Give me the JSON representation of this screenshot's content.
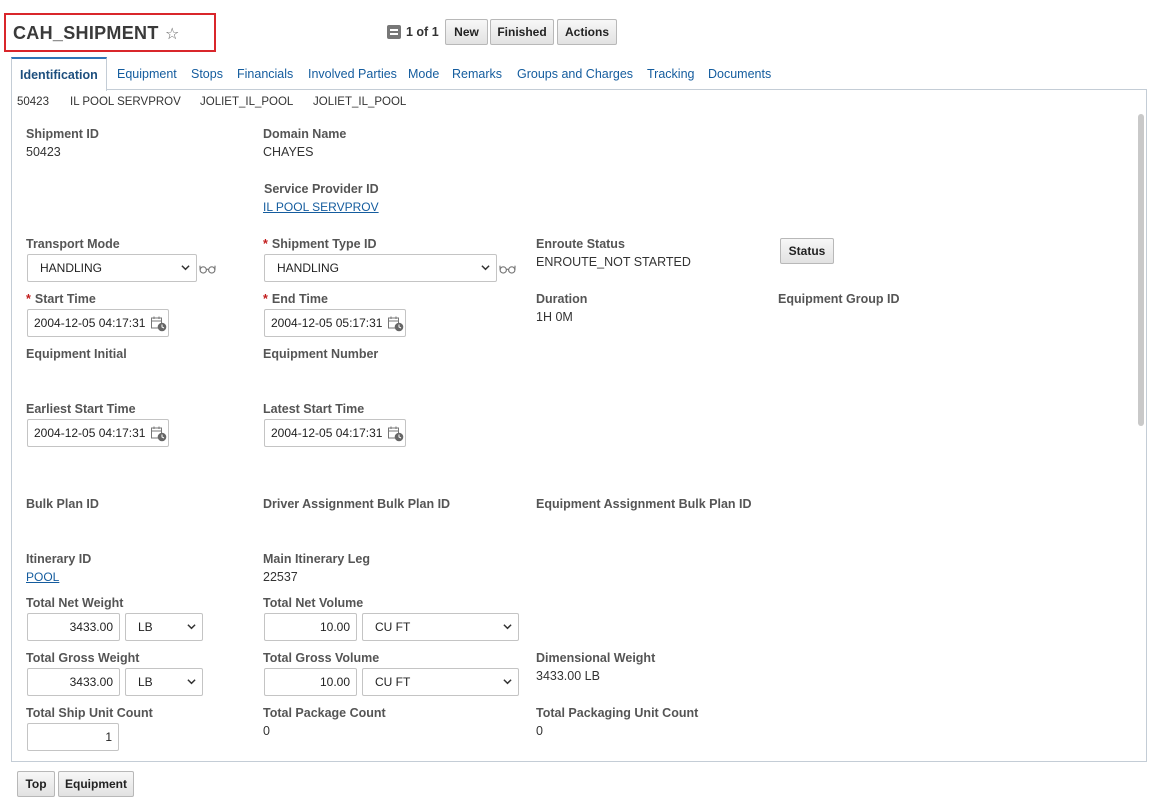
{
  "header": {
    "title": "CAH_SHIPMENT",
    "favorite_glyph": "☆",
    "pager_text": "1 of 1",
    "new_label": "New",
    "finished_label": "Finished",
    "actions_label": "Actions",
    "highlight_color": "#d9262b"
  },
  "tabs": [
    {
      "label": "Identification",
      "active": true
    },
    {
      "label": "Equipment"
    },
    {
      "label": "Stops"
    },
    {
      "label": "Financials"
    },
    {
      "label": "Involved Parties"
    },
    {
      "label": "Mode"
    },
    {
      "label": "Remarks"
    },
    {
      "label": "Groups and Charges"
    },
    {
      "label": "Tracking"
    },
    {
      "label": "Documents"
    }
  ],
  "summary": [
    "50423",
    "IL POOL SERVPROV",
    "JOLIET_IL_POOL",
    "JOLIET_IL_POOL"
  ],
  "form": {
    "shipment_id": {
      "label": "Shipment ID",
      "value": "50423"
    },
    "domain_name": {
      "label": "Domain Name",
      "value": "CHAYES"
    },
    "service_provider_id": {
      "label": "Service Provider ID",
      "value": "IL POOL SERVPROV"
    },
    "transport_mode": {
      "label": "Transport Mode",
      "value": "HANDLING"
    },
    "shipment_type_id": {
      "label": "Shipment Type ID",
      "value": "HANDLING"
    },
    "enroute_status": {
      "label": "Enroute Status",
      "value": "ENROUTE_NOT STARTED",
      "button": "Status"
    },
    "start_time": {
      "label": "Start Time",
      "value": "2004-12-05 04:17:31"
    },
    "end_time": {
      "label": "End Time",
      "value": "2004-12-05 05:17:31"
    },
    "duration": {
      "label": "Duration",
      "value": "1H 0M"
    },
    "equipment_group_id": {
      "label": "Equipment Group ID"
    },
    "equipment_initial": {
      "label": "Equipment Initial"
    },
    "equipment_number": {
      "label": "Equipment Number"
    },
    "earliest_start_time": {
      "label": "Earliest Start Time",
      "value": "2004-12-05 04:17:31"
    },
    "latest_start_time": {
      "label": "Latest Start Time",
      "value": "2004-12-05 04:17:31"
    },
    "bulk_plan_id": {
      "label": "Bulk Plan ID"
    },
    "driver_assignment_bulk_plan_id": {
      "label": "Driver Assignment Bulk Plan ID"
    },
    "equipment_assignment_bulk_plan_id": {
      "label": "Equipment Assignment Bulk Plan ID"
    },
    "itinerary_id": {
      "label": "Itinerary ID",
      "value": "POOL"
    },
    "main_itinerary_leg": {
      "label": "Main Itinerary Leg",
      "value": "22537"
    },
    "total_net_weight": {
      "label": "Total Net Weight",
      "value": "3433.00",
      "unit": "LB"
    },
    "total_net_volume": {
      "label": "Total Net Volume",
      "value": "10.00",
      "unit": "CU FT"
    },
    "total_gross_weight": {
      "label": "Total Gross Weight",
      "value": "3433.00",
      "unit": "LB"
    },
    "total_gross_volume": {
      "label": "Total Gross Volume",
      "value": "10.00",
      "unit": "CU FT"
    },
    "dimensional_weight": {
      "label": "Dimensional Weight",
      "value": "3433.00 LB"
    },
    "total_ship_unit_count": {
      "label": "Total Ship Unit Count",
      "value": "1"
    },
    "total_package_count": {
      "label": "Total Package Count",
      "value": "0"
    },
    "total_packaging_unit_count": {
      "label": "Total Packaging Unit Count",
      "value": "0"
    }
  },
  "footer": {
    "top_label": "Top",
    "equipment_label": "Equipment"
  },
  "colors": {
    "link": "#145c9e",
    "required": "#c21c1c",
    "border": "#c4cdd6"
  }
}
